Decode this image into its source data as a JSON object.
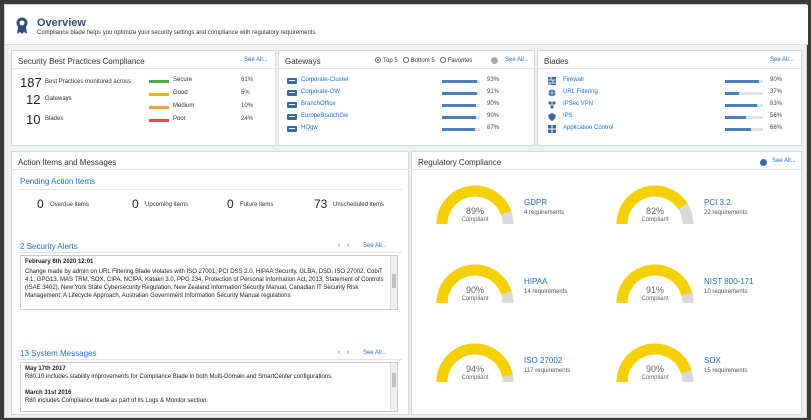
{
  "header": {
    "title": "Overview",
    "subtitle": "Compliance blade helps you optimize your security settings and compliance with regulatory requirements."
  },
  "sbp": {
    "title": "Security Best Practices Compliance",
    "see_all": "See All...",
    "monitored_count": "187",
    "monitored_label": "Best Practices monitored across",
    "gateways_count": "12",
    "gateways_label": "Gateways",
    "blades_count": "10",
    "blades_label": "Blades",
    "levels": [
      {
        "label": "Secure",
        "pct": "61%",
        "color": "#4caf50",
        "value": 0.61
      },
      {
        "label": "Good",
        "pct": "5%",
        "color": "#e6b800",
        "value": 0.05
      },
      {
        "label": "Medium",
        "pct": "10%",
        "color": "#f0a030",
        "value": 0.1
      },
      {
        "label": "Poor",
        "pct": "24%",
        "color": "#e05050",
        "value": 0.24
      }
    ]
  },
  "gateways": {
    "title": "Gateways",
    "see_all": "See All...",
    "filters": [
      {
        "label": "Top 5",
        "selected": true
      },
      {
        "label": "Bottom 5",
        "selected": false
      },
      {
        "label": "Favorites",
        "selected": false
      }
    ],
    "items": [
      {
        "name": "Corporate-Cluster",
        "pct": "93%",
        "value": 0.93
      },
      {
        "name": "Corporate-GW",
        "pct": "91%",
        "value": 0.91
      },
      {
        "name": "BranchOffice",
        "pct": "90%",
        "value": 0.9
      },
      {
        "name": "EuropeBranchGw",
        "pct": "90%",
        "value": 0.9
      },
      {
        "name": "HQgw",
        "pct": "87%",
        "value": 0.87
      }
    ]
  },
  "blades": {
    "title": "Blades",
    "see_all": "See All...",
    "items": [
      {
        "name": "Firewall",
        "pct": "90%",
        "value": 0.9,
        "icon": "firewall-icon"
      },
      {
        "name": "URL Filtering",
        "pct": "37%",
        "value": 0.37,
        "icon": "globe-icon"
      },
      {
        "name": "IPSec VPN",
        "pct": "83%",
        "value": 0.83,
        "icon": "vpn-icon"
      },
      {
        "name": "IPS",
        "pct": "56%",
        "value": 0.56,
        "icon": "shield-icon"
      },
      {
        "name": "Application Control",
        "pct": "68%",
        "value": 0.68,
        "icon": "app-control-icon"
      }
    ]
  },
  "actions": {
    "title": "Action Items and Messages",
    "pending_title": "Pending Action Items",
    "counts": [
      {
        "num": "0",
        "label": "Overdue items"
      },
      {
        "num": "0",
        "label": "Upcoming items"
      },
      {
        "num": "0",
        "label": "Future items"
      },
      {
        "num": "73",
        "label": "Unscheduled items"
      }
    ],
    "alerts_title": "2 Security Alerts",
    "alerts_see_all": "See All...",
    "alert_date": "February 6th 2020 12:01",
    "alert_text": "Change made by admin on URL Filtering Blade violates with ISO 27001, PCI DSS 2.0, HIPAA Security, GLBA, DSD, ISO 27002, CobiT 4.1, GPG13, MAS TRM, SOX, CIPA, NCIPA, Katakri 3.0, PPG 234, Protection of Personal Information Act, 2013, Statement of Controls (ISAE 3402), New York State Cybersecurity Regulation, New Zealand Information Security Manual, Canadian IT Security Risk Management: A Lifecycle Approach, Australian Government Information Security Manual regulations",
    "messages_title": "13 System Messages",
    "messages_see_all": "See All...",
    "messages": [
      {
        "date": "May 17th 2017",
        "text": "R80.10 includes stability improvements for Compliance Blade in both Multi-Domain and SmartCenter configurations."
      },
      {
        "date": "March 31st 2016",
        "text": "R80 includes Compliance blade as part of its Logs & Monitor section."
      }
    ]
  },
  "regulatory": {
    "title": "Regulatory Compliance",
    "see_all": "See All...",
    "compliant_label": "Compliant",
    "items": [
      {
        "name": "GDPR",
        "pct": "89%",
        "value": 0.89,
        "reqs": "4 requirements"
      },
      {
        "name": "PCI 3.2",
        "pct": "82%",
        "value": 0.82,
        "reqs": "22 requirements"
      },
      {
        "name": "HIPAA",
        "pct": "90%",
        "value": 0.9,
        "reqs": "14 requirements"
      },
      {
        "name": "NIST 800-171",
        "pct": "91%",
        "value": 0.91,
        "reqs": "10 requirements"
      },
      {
        "name": "ISO 27002",
        "pct": "94%",
        "value": 0.94,
        "reqs": "117 requirements"
      },
      {
        "name": "SOX",
        "pct": "90%",
        "value": 0.9,
        "reqs": "15 requirements"
      }
    ]
  },
  "colors": {
    "accent": "#1f6fc0",
    "gauge": "#f5d000",
    "gauge_bg": "#d9d9d9",
    "bar_blue": "#4a7fb5"
  }
}
